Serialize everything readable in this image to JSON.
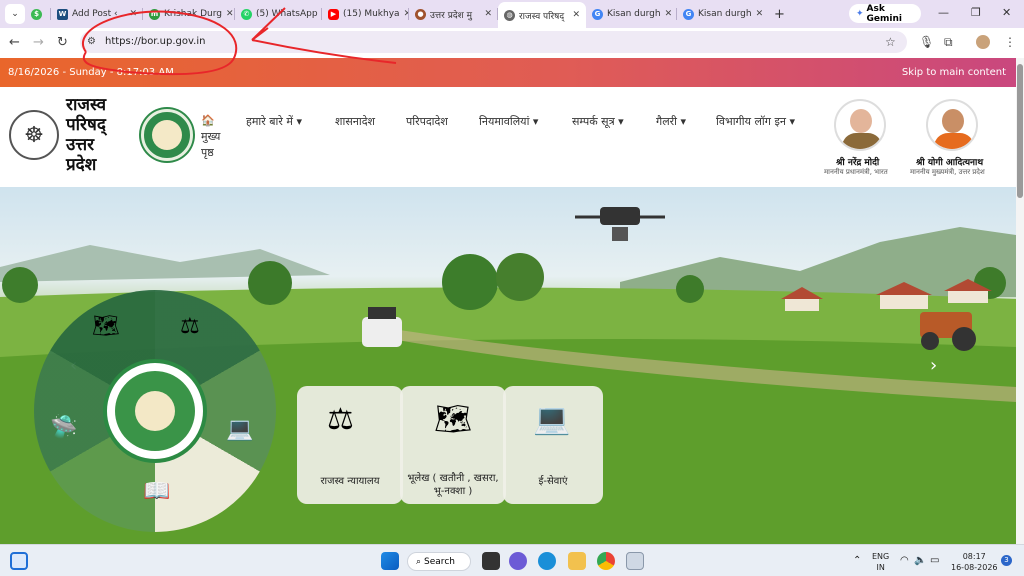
{
  "browser": {
    "tabs": [
      {
        "title": "",
        "favicon": "green-circle"
      },
      {
        "title": "Add Post ‹ ",
        "favicon": "wordpress"
      },
      {
        "title": "Krishak Durg",
        "favicon": "my-green"
      },
      {
        "title": "(5) WhatsApp",
        "favicon": "whatsapp"
      },
      {
        "title": "(15) Mukhya",
        "favicon": "youtube"
      },
      {
        "title": "उत्तर प्रदेश मु",
        "favicon": "up-emblem"
      },
      {
        "title": "राजस्व परिषद्",
        "favicon": "globe",
        "active": true
      },
      {
        "title": "Kisan durgh",
        "favicon": "google"
      },
      {
        "title": "Kisan durgh",
        "favicon": "google"
      }
    ],
    "new_tab": "+",
    "ask_gemini": "Ask Gemini",
    "url": "https://bor.up.gov.in"
  },
  "strip": {
    "date": "8/16/2026 - Sunday - 8:17:03 AM",
    "skip": "Skip to main content"
  },
  "header": {
    "site_title_lines": [
      "राजस्व",
      "परिषद्",
      "उत्तर",
      "प्रदेश"
    ],
    "home_label": "मुख्य पृष्ठ",
    "menu": [
      {
        "label": "हमारे बारे में",
        "dropdown": true
      },
      {
        "label": "शासनादेश",
        "dropdown": false
      },
      {
        "label": "परिपदादेश",
        "dropdown": false
      },
      {
        "label": "नियमावलियां",
        "dropdown": true
      },
      {
        "label": "सम्पर्क सूत्र",
        "dropdown": true
      },
      {
        "label": "गैलरी",
        "dropdown": true
      },
      {
        "label": "विभागीय लॉग इन",
        "dropdown": true
      }
    ],
    "leaders": [
      {
        "name": "श्री नरेंद्र मोदी",
        "role": "माननीय प्रधानमंत्री, भारत"
      },
      {
        "name": "श्री योगी आदित्यनाथ",
        "role": "माननीय मुख्यमंत्री, उत्तर प्रदेश"
      }
    ]
  },
  "hero": {
    "prev": "‹",
    "next": "›",
    "cards": [
      {
        "label": "राजस्व न्यायालय",
        "icon": "gavel-icon"
      },
      {
        "label": "भूलेख ( खतौनी , खसरा, भू-नक्शा )",
        "icon": "map-document-icon"
      },
      {
        "label": "ई-सेवाएं",
        "icon": "e-service-icon"
      }
    ]
  },
  "taskbar": {
    "search_label": "Search",
    "lang_top": "ENG",
    "lang_bottom": "IN",
    "time": "08:17",
    "date": "16-08-2026",
    "notifications": "3"
  }
}
